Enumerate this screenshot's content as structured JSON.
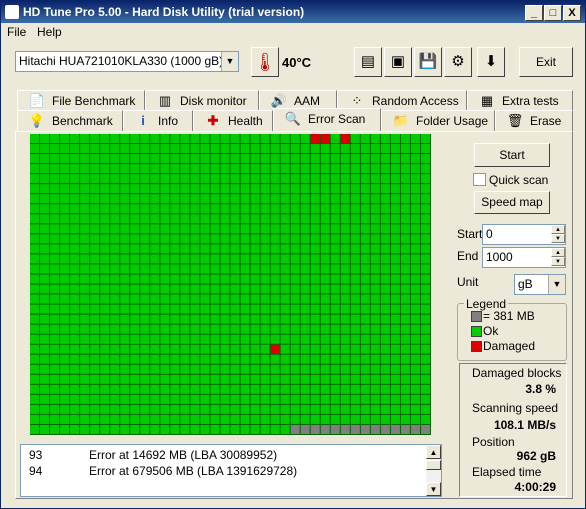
{
  "window": {
    "title": "HD Tune Pro 5.00 - Hard Disk Utility (trial version)",
    "minimize": "_",
    "maximize": "□",
    "close": "X"
  },
  "menu": {
    "file": "File",
    "help": "Help"
  },
  "toolbar": {
    "drive": "Hitachi HUA721010KLA330 (1000 gB)",
    "temperature": "40°C",
    "exit_label": "Exit",
    "icons": [
      "copy-text-icon",
      "copy-screenshot-icon",
      "save-icon",
      "options-icon",
      "download-icon"
    ]
  },
  "tabs_top": [
    {
      "label": "File Benchmark",
      "icon": "file-benchmark-icon"
    },
    {
      "label": "Disk monitor",
      "icon": "disk-monitor-icon"
    },
    {
      "label": "AAM",
      "icon": "speaker-icon"
    },
    {
      "label": "Random Access",
      "icon": "random-access-icon"
    },
    {
      "label": "Extra tests",
      "icon": "extra-tests-icon"
    }
  ],
  "tabs_bottom": [
    {
      "label": "Benchmark",
      "icon": "benchmark-bulb-icon"
    },
    {
      "label": "Info",
      "icon": "info-icon"
    },
    {
      "label": "Health",
      "icon": "health-cross-icon"
    },
    {
      "label": "Error Scan",
      "icon": "magnifier-icon",
      "active": true
    },
    {
      "label": "Folder Usage",
      "icon": "folder-icon"
    },
    {
      "label": "Erase",
      "icon": "trash-icon"
    }
  ],
  "scan_grid": {
    "cols": 40,
    "rows": 30,
    "scanned_cells": 1186,
    "damaged_cells": [
      [
        0,
        28
      ],
      [
        0,
        29
      ],
      [
        0,
        31
      ],
      [
        21,
        24
      ]
    ],
    "colors": {
      "ok": "#00cc00",
      "damaged": "#dd0000",
      "unscanned": "#808080",
      "gridline": "#006600"
    }
  },
  "log": {
    "rows": [
      {
        "num": "93",
        "msg": "Error at 14692 MB (LBA 30089952)"
      },
      {
        "num": "94",
        "msg": "Error at 679506 MB (LBA 1391629728)"
      }
    ]
  },
  "controls": {
    "start_label": "Start",
    "quick_scan_label": "Quick scan",
    "quick_scan_checked": false,
    "speed_map_label": "Speed map",
    "start_field_label": "Start",
    "start_value": "0",
    "end_field_label": "End",
    "end_value": "1000",
    "unit_label": "Unit",
    "unit_value": "gB"
  },
  "legend": {
    "title": "Legend",
    "block_size": "= 381 MB",
    "ok": "Ok",
    "damaged": "Damaged"
  },
  "stats": {
    "damaged_blocks_label": "Damaged blocks",
    "damaged_blocks_value": "3.8 %",
    "scanning_speed_label": "Scanning speed",
    "scanning_speed_value": "108.1 MB/s",
    "position_label": "Position",
    "position_value": "962 gB",
    "elapsed_label": "Elapsed time",
    "elapsed_value": "4:00:29"
  }
}
